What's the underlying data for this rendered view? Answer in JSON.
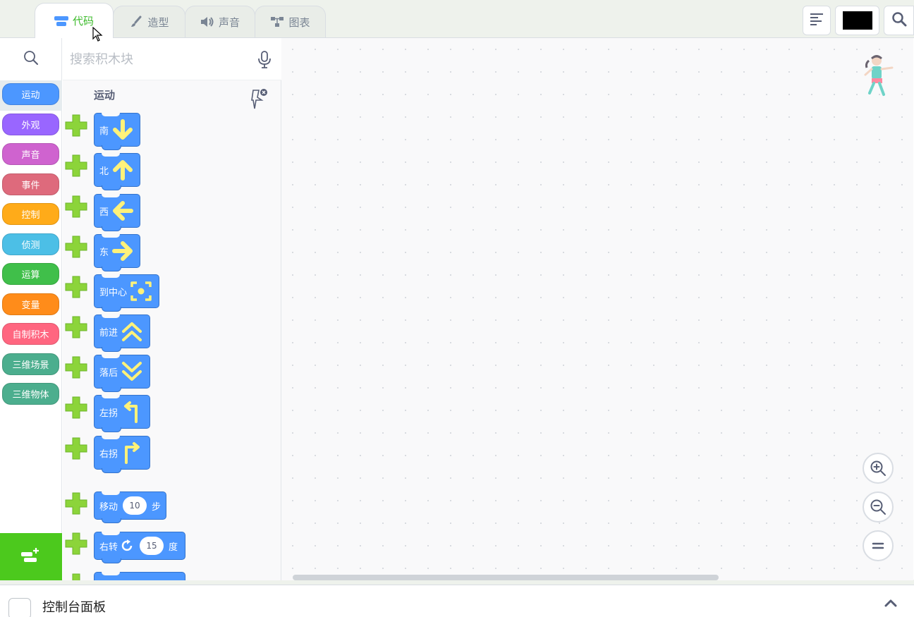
{
  "tabs": [
    {
      "label": "代码",
      "icon": "code-icon",
      "active": true
    },
    {
      "label": "造型",
      "icon": "brush-icon",
      "active": false
    },
    {
      "label": "声音",
      "icon": "speaker-icon",
      "active": false
    },
    {
      "label": "图表",
      "icon": "chart-icon",
      "active": false
    }
  ],
  "toolbar": {
    "align_icon": "align-left-icon",
    "color": "#000000",
    "search_icon": "search-icon"
  },
  "categories": [
    {
      "label": "运动",
      "color": "#4c97ff"
    },
    {
      "label": "外观",
      "color": "#9966ff"
    },
    {
      "label": "声音",
      "color": "#cf63cf"
    },
    {
      "label": "事件",
      "color": "#de6a7c"
    },
    {
      "label": "控制",
      "color": "#ffab19"
    },
    {
      "label": "侦测",
      "color": "#4cbfe6"
    },
    {
      "label": "运算",
      "color": "#40bf4a"
    },
    {
      "label": "变量",
      "color": "#ff8c1a"
    },
    {
      "label": "自制积木",
      "color": "#ff6680"
    },
    {
      "label": "三维场景",
      "color": "#4cae8e"
    },
    {
      "label": "三维物体",
      "color": "#4cae8e"
    }
  ],
  "search": {
    "placeholder": "搜索积木块"
  },
  "palette": {
    "title": "运动",
    "blocks": [
      {
        "label": "南",
        "icon": "arrow-down-icon"
      },
      {
        "label": "北",
        "icon": "arrow-up-icon"
      },
      {
        "label": "西",
        "icon": "arrow-left-icon"
      },
      {
        "label": "东",
        "icon": "arrow-right-icon"
      },
      {
        "label": "到中心",
        "icon": "center-target-icon"
      },
      {
        "label": "前进",
        "icon": "double-chevron-up-icon"
      },
      {
        "label": "落后",
        "icon": "double-chevron-down-icon"
      },
      {
        "label": "左拐",
        "icon": "turn-left-icon"
      },
      {
        "label": "右拐",
        "icon": "turn-right-icon"
      }
    ],
    "move_block": {
      "label": "移动",
      "value": "10",
      "suffix": "步"
    },
    "turn_block": {
      "label": "右转",
      "value": "15",
      "suffix": "度"
    }
  },
  "console": {
    "label": "控制台面板"
  }
}
